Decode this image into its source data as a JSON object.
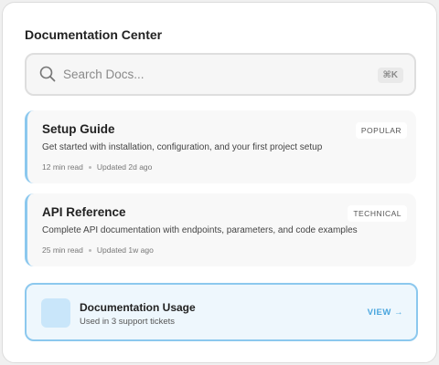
{
  "header": {
    "title": "Documentation Center"
  },
  "search": {
    "placeholder": "Search Docs...",
    "shortcut": "⌘K",
    "icon": "search-icon"
  },
  "docs": [
    {
      "title": "Setup Guide",
      "badge": "POPULAR",
      "description": "Get started with installation, configuration, and your first project setup",
      "read_time": "12 min read",
      "updated": "Updated 2d ago"
    },
    {
      "title": "API Reference",
      "badge": "TECHNICAL",
      "description": "Complete API documentation with endpoints, parameters, and code examples",
      "read_time": "25 min read",
      "updated": "Updated 1w ago"
    }
  ],
  "usage": {
    "title": "Documentation Usage",
    "subtitle": "Used in 3 support tickets",
    "action": "VIEW →"
  },
  "colors": {
    "accent": "#8cc8ee",
    "accent_text": "#4aa6de",
    "usage_bg": "#eef7fd"
  }
}
